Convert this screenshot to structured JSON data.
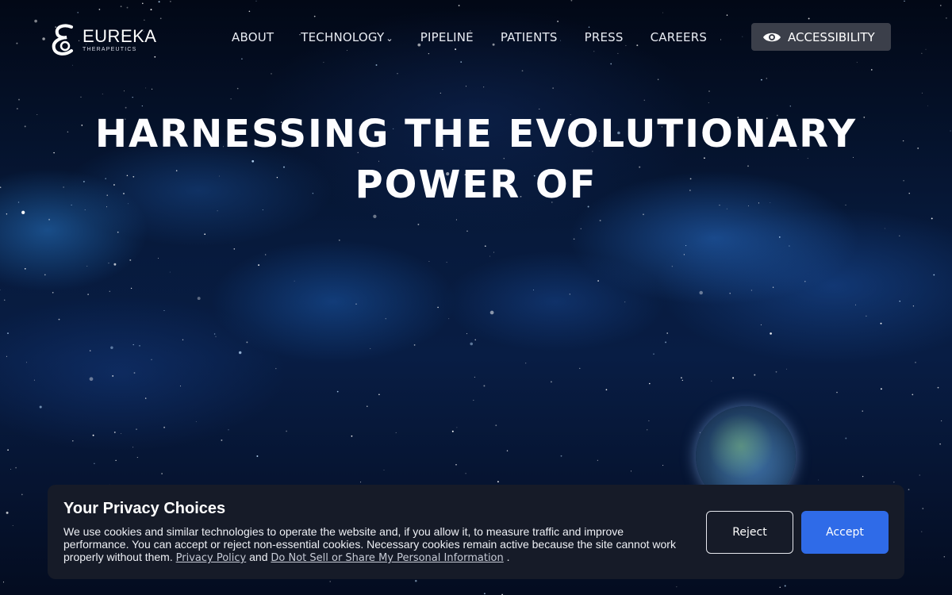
{
  "brand": {
    "name": "EUREKA",
    "subtitle": "THERAPEUTICS",
    "registered": "®"
  },
  "nav": {
    "items": [
      {
        "label": "ABOUT",
        "dropdown": false
      },
      {
        "label": "TECHNOLOGY",
        "dropdown": true
      },
      {
        "label": "PIPELINE",
        "dropdown": false
      },
      {
        "label": "PATIENTS",
        "dropdown": false
      },
      {
        "label": "PRESS",
        "dropdown": false
      },
      {
        "label": "CAREERS",
        "dropdown": false
      }
    ],
    "accessibility_label": "ACCESSIBILITY",
    "accessibility_icon": "eye-icon",
    "dropdown_icon": "chevron-down-icon"
  },
  "hero": {
    "headline": "HARNESSING THE EVOLUTIONARY POWER OF"
  },
  "privacy": {
    "title": "Your Privacy Choices",
    "body": "We use cookies and similar technologies to operate the website and, if you allow it, to measure traffic and improve performance. You can accept or reject non-essential cookies. Necessary cookies remain active because the site cannot work properly without them.",
    "link_policy": "Privacy Policy",
    "joiner": "and",
    "link_dns": "Do Not Sell or Share My Personal Information",
    "trailing": ".",
    "reject_label": "Reject",
    "accept_label": "Accept"
  },
  "colors": {
    "background": "#040a1c",
    "accent_blue": "#2f6be8",
    "banner_bg": "#161b28",
    "a11y_button_bg": "#3b3f4a"
  }
}
